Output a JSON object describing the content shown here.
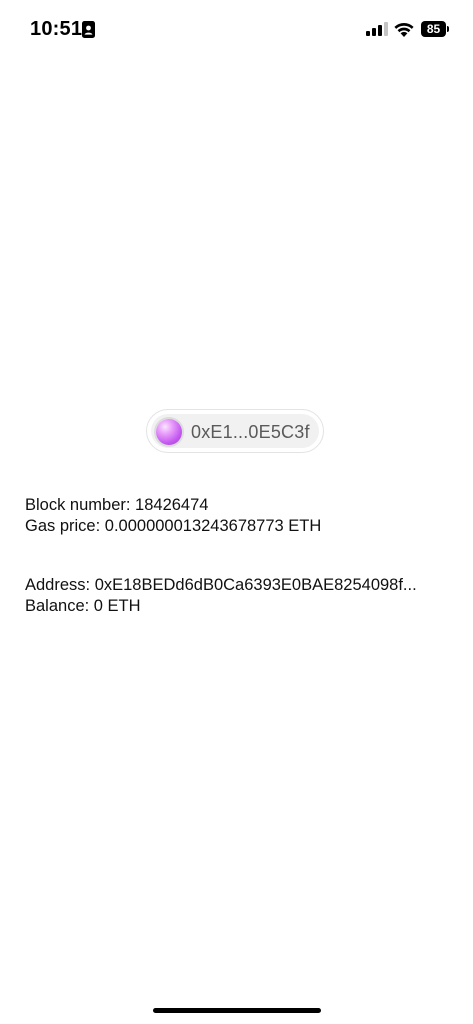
{
  "status_bar": {
    "time": "10:51",
    "battery_level": "85",
    "icons": [
      "contact-card-icon",
      "cellular-signal-icon",
      "wifi-icon",
      "battery-icon"
    ]
  },
  "account_button": {
    "label": "0xE1...0E5C3f",
    "avatar_colors": [
      "#fbe6ff",
      "#e79cfa",
      "#c45af0",
      "#9a36d6"
    ]
  },
  "network_info": {
    "block_number": "Block number: 18426474",
    "gas_price": "Gas price: 0.000000013243678773 ETH"
  },
  "account_info": {
    "address": "Address: 0xE18BEDd6dB0Ca6393E0BAE8254098f...",
    "balance": "Balance: 0 ETH"
  }
}
